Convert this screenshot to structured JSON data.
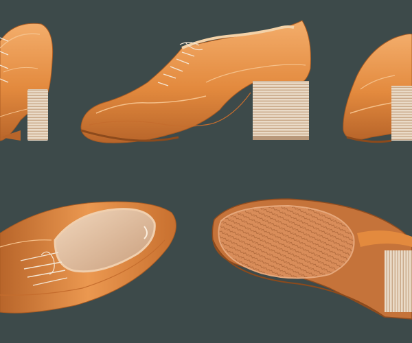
{
  "scene": {
    "background_color": "#3d4a4a",
    "leather_color": "#e38a3e",
    "leather_highlight": "#f2a864",
    "leather_shadow": "#a85a22",
    "lining_color": "#e6c3a3",
    "heel_stripe_light": "#eadbc8",
    "heel_stripe_dark": "#c9a888",
    "lace_color": "#f4e6d4",
    "sole_color": "#d98d5a"
  },
  "views": [
    {
      "id": "back-three-quarter",
      "icon": "shoe-back-view"
    },
    {
      "id": "side-profile",
      "icon": "shoe-side-view"
    },
    {
      "id": "heel-close-up",
      "icon": "shoe-heel-view"
    },
    {
      "id": "top-down-opening",
      "icon": "shoe-top-view"
    },
    {
      "id": "bottom-outsole",
      "icon": "shoe-sole-view"
    }
  ]
}
